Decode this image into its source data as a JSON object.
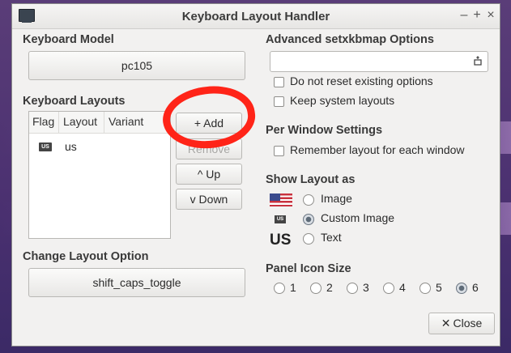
{
  "window": {
    "title": "Keyboard Layout Handler",
    "controls": {
      "minimize": "–",
      "maximize": "+",
      "close": "×"
    }
  },
  "keyboard_model": {
    "label": "Keyboard Model",
    "value": "pc105"
  },
  "keyboard_layouts": {
    "label": "Keyboard Layouts",
    "columns": [
      "Flag",
      "Layout",
      "Variant"
    ],
    "rows": [
      {
        "flag": "US",
        "layout": "us",
        "variant": ""
      }
    ]
  },
  "layout_buttons": {
    "add": "+ Add",
    "remove": "Remove",
    "up": "^ Up",
    "down": "v Down"
  },
  "change_layout_option": {
    "label": "Change Layout Option",
    "value": "shift_caps_toggle"
  },
  "advanced": {
    "label": "Advanced setxkbmap Options",
    "input_value": "",
    "no_reset": "Do not reset existing options",
    "keep_system": "Keep system layouts"
  },
  "per_window": {
    "label": "Per Window Settings",
    "remember": "Remember layout for each window"
  },
  "show_layout": {
    "label": "Show Layout as",
    "options": [
      "Image",
      "Custom Image",
      "Text"
    ],
    "selected": "Custom Image",
    "preview_text": "US",
    "mini_flag": "US"
  },
  "panel_icon_size": {
    "label": "Panel Icon Size",
    "options": [
      "1",
      "2",
      "3",
      "4",
      "5",
      "6"
    ],
    "selected": "6"
  },
  "close_button": "Close",
  "colors": {
    "annotation": "#ff2418",
    "desktop": "#4a3070"
  }
}
